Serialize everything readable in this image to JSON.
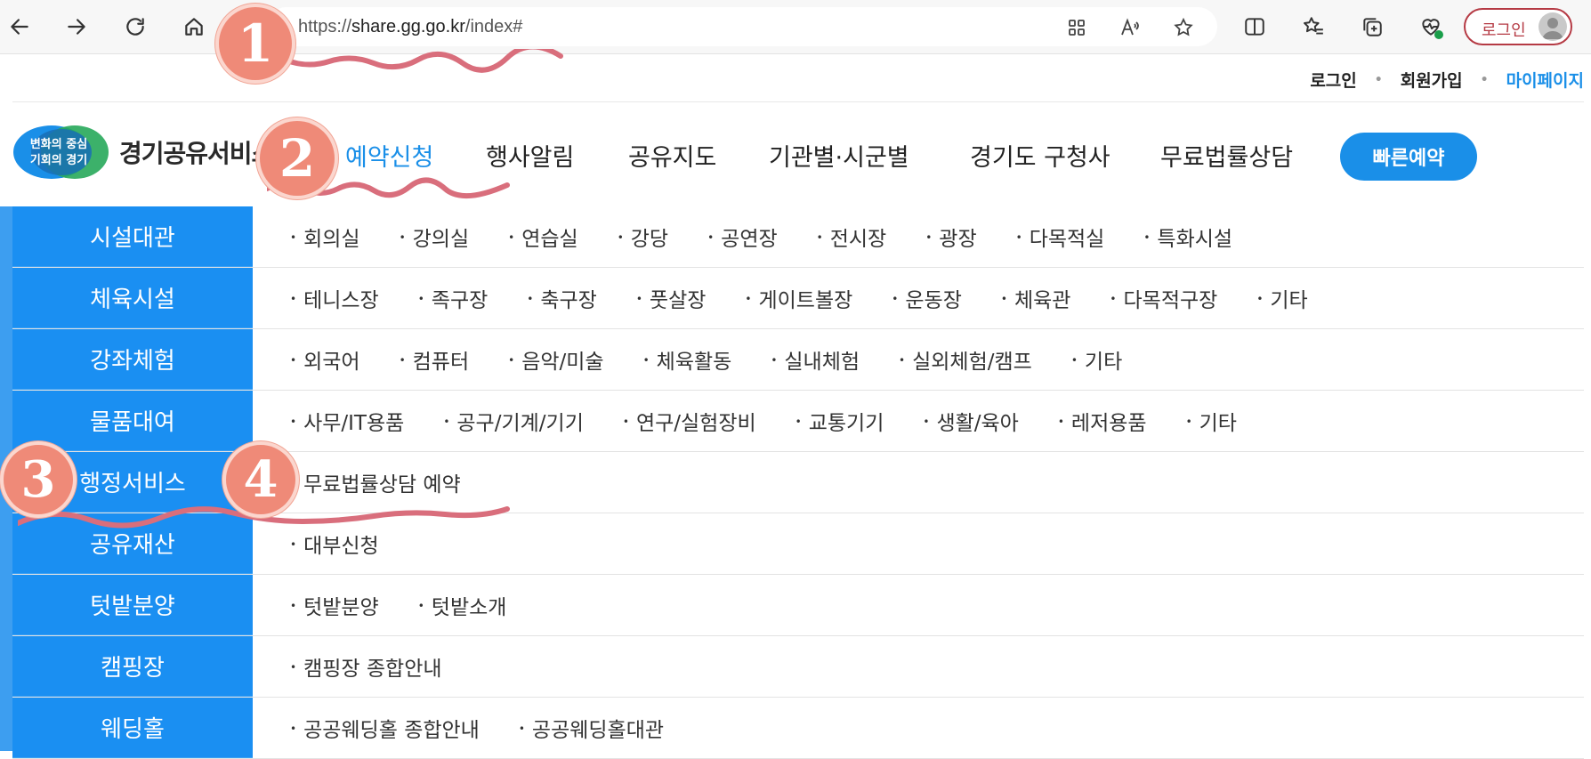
{
  "browser": {
    "url_prefix": "https://",
    "url_domain": "share.gg.go.kr",
    "url_path": "/index#",
    "profile_label": "로그인",
    "icons": [
      "back-icon",
      "forward-icon",
      "refresh-icon",
      "home-icon",
      "app-grid-icon",
      "read-aloud-icon",
      "star-icon",
      "split-screen-icon",
      "favorites-icon",
      "collections-icon",
      "health-icon",
      "profile-avatar-icon"
    ],
    "accent": "#b53a44"
  },
  "site": {
    "top_links": {
      "login": "로그인",
      "signup": "회원가입",
      "mypage": "마이페이지"
    },
    "logo": {
      "badge_line1": "변화의 중심",
      "badge_line2": "기회의 경기",
      "name": "경기공유서비스"
    },
    "gnb": [
      "예약신청",
      "행사알림",
      "공유지도",
      "기관별·시군별",
      "경기도 구청사",
      "무료법률상담"
    ],
    "quick_button": "빠른예약",
    "accent": "#1a8fe8",
    "menu": [
      {
        "category": "시설대관",
        "items": [
          "회의실",
          "강의실",
          "연습실",
          "강당",
          "공연장",
          "전시장",
          "광장",
          "다목적실",
          "특화시설"
        ]
      },
      {
        "category": "체육시설",
        "items": [
          "테니스장",
          "족구장",
          "축구장",
          "풋살장",
          "게이트볼장",
          "운동장",
          "체육관",
          "다목적구장",
          "기타"
        ]
      },
      {
        "category": "강좌체험",
        "items": [
          "외국어",
          "컴퓨터",
          "음악/미술",
          "체육활동",
          "실내체험",
          "실외체험/캠프",
          "기타"
        ]
      },
      {
        "category": "물품대여",
        "items": [
          "사무/IT용품",
          "공구/기계/기기",
          "연구/실험장비",
          "교통기기",
          "생활/육아",
          "레저용품",
          "기타"
        ]
      },
      {
        "category": "행정서비스",
        "items": [
          "무료법률상담 예약"
        ]
      },
      {
        "category": "공유재산",
        "items": [
          "대부신청"
        ]
      },
      {
        "category": "텃밭분양",
        "items": [
          "텃밭분양",
          "텃밭소개"
        ]
      },
      {
        "category": "캠핑장",
        "items": [
          "캠핑장 종합안내"
        ]
      },
      {
        "category": "웨딩홀",
        "items": [
          "공공웨딩홀 종합안내",
          "공공웨딩홀대관"
        ]
      }
    ]
  },
  "annotations": [
    "1",
    "2",
    "3",
    "4"
  ]
}
